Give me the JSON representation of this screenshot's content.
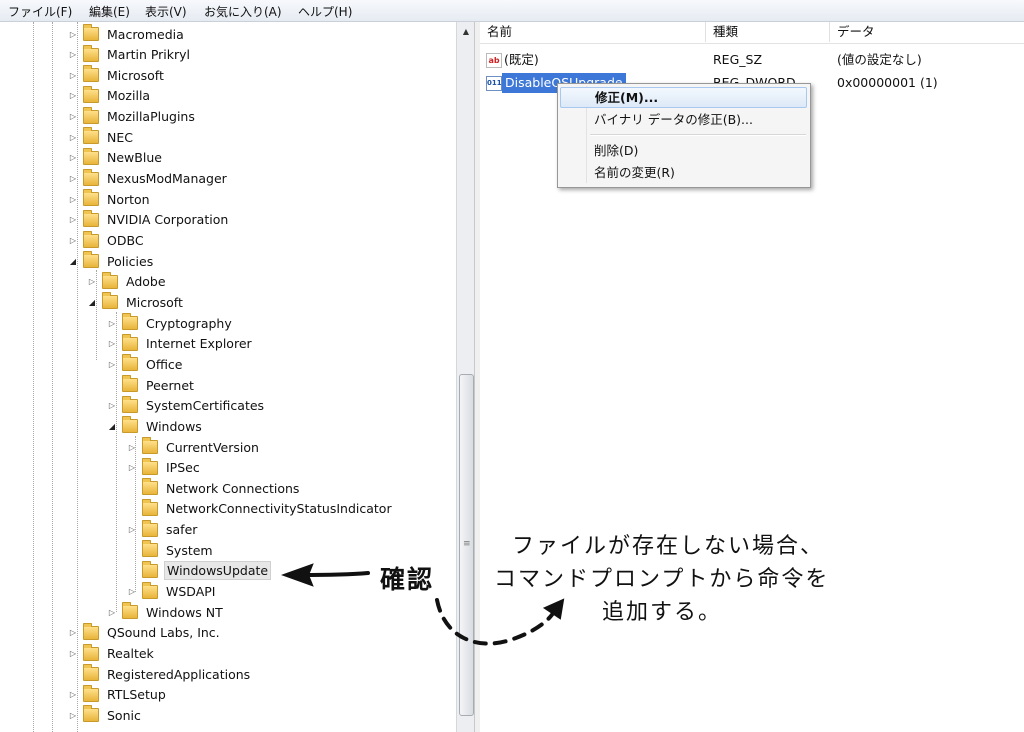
{
  "menubar": {
    "items": [
      "ファイル(F)",
      "編集(E)",
      "表示(V)",
      "お気に入り(A)",
      "ヘルプ(H)"
    ]
  },
  "tree": {
    "nodes": [
      {
        "label": "Macromedia",
        "expander": "▷"
      },
      {
        "label": "Martin Prikryl",
        "expander": "▷"
      },
      {
        "label": "Microsoft",
        "expander": "▷"
      },
      {
        "label": "Mozilla",
        "expander": "▷"
      },
      {
        "label": "MozillaPlugins",
        "expander": "▷"
      },
      {
        "label": "NEC",
        "expander": "▷"
      },
      {
        "label": "NewBlue",
        "expander": "▷"
      },
      {
        "label": "NexusModManager",
        "expander": "▷"
      },
      {
        "label": "Norton",
        "expander": "▷"
      },
      {
        "label": "NVIDIA Corporation",
        "expander": "▷"
      },
      {
        "label": "ODBC",
        "expander": "▷"
      },
      {
        "label": "Policies",
        "expander": "◢"
      },
      {
        "label": "Adobe",
        "expander": "▷"
      },
      {
        "label": "Microsoft",
        "expander": "◢"
      },
      {
        "label": "Cryptography",
        "expander": "▷"
      },
      {
        "label": "Internet Explorer",
        "expander": "▷"
      },
      {
        "label": "Office",
        "expander": "▷"
      },
      {
        "label": "Peernet",
        "expander": ""
      },
      {
        "label": "SystemCertificates",
        "expander": "▷"
      },
      {
        "label": "Windows",
        "expander": "◢"
      },
      {
        "label": "CurrentVersion",
        "expander": "▷"
      },
      {
        "label": "IPSec",
        "expander": "▷"
      },
      {
        "label": "Network Connections",
        "expander": ""
      },
      {
        "label": "NetworkConnectivityStatusIndicator",
        "expander": ""
      },
      {
        "label": "safer",
        "expander": "▷"
      },
      {
        "label": "System",
        "expander": ""
      },
      {
        "label": "WindowsUpdate",
        "expander": ""
      },
      {
        "label": "WSDAPI",
        "expander": "▷"
      },
      {
        "label": "Windows NT",
        "expander": "▷"
      },
      {
        "label": "QSound Labs, Inc.",
        "expander": "▷"
      },
      {
        "label": "Realtek",
        "expander": "▷"
      },
      {
        "label": "RegisteredApplications",
        "expander": ""
      },
      {
        "label": "RTLSetup",
        "expander": "▷"
      },
      {
        "label": "Sonic",
        "expander": "▷"
      }
    ]
  },
  "list": {
    "columns": [
      "名前",
      "種類",
      "データ"
    ],
    "rows": [
      {
        "icon": "string-value-icon",
        "icon_text": "ab",
        "name": "(既定)",
        "type": "REG_SZ",
        "data": "(値の設定なし)"
      },
      {
        "icon": "binary-value-icon",
        "icon_text": "011",
        "name": "DisableOSUpgrade",
        "type": "REG_DWORD",
        "data": "0x00000001 (1)"
      }
    ]
  },
  "context_menu": {
    "items": [
      "修正(M)...",
      "バイナリ データの修正(B)...",
      "削除(D)",
      "名前の変更(R)"
    ]
  },
  "annotation": {
    "confirm": "確認",
    "note_line1": "ファイルが存在しない場合、",
    "note_line2": "コマンドプロンプトから命令を",
    "note_line3": "追加する。"
  }
}
